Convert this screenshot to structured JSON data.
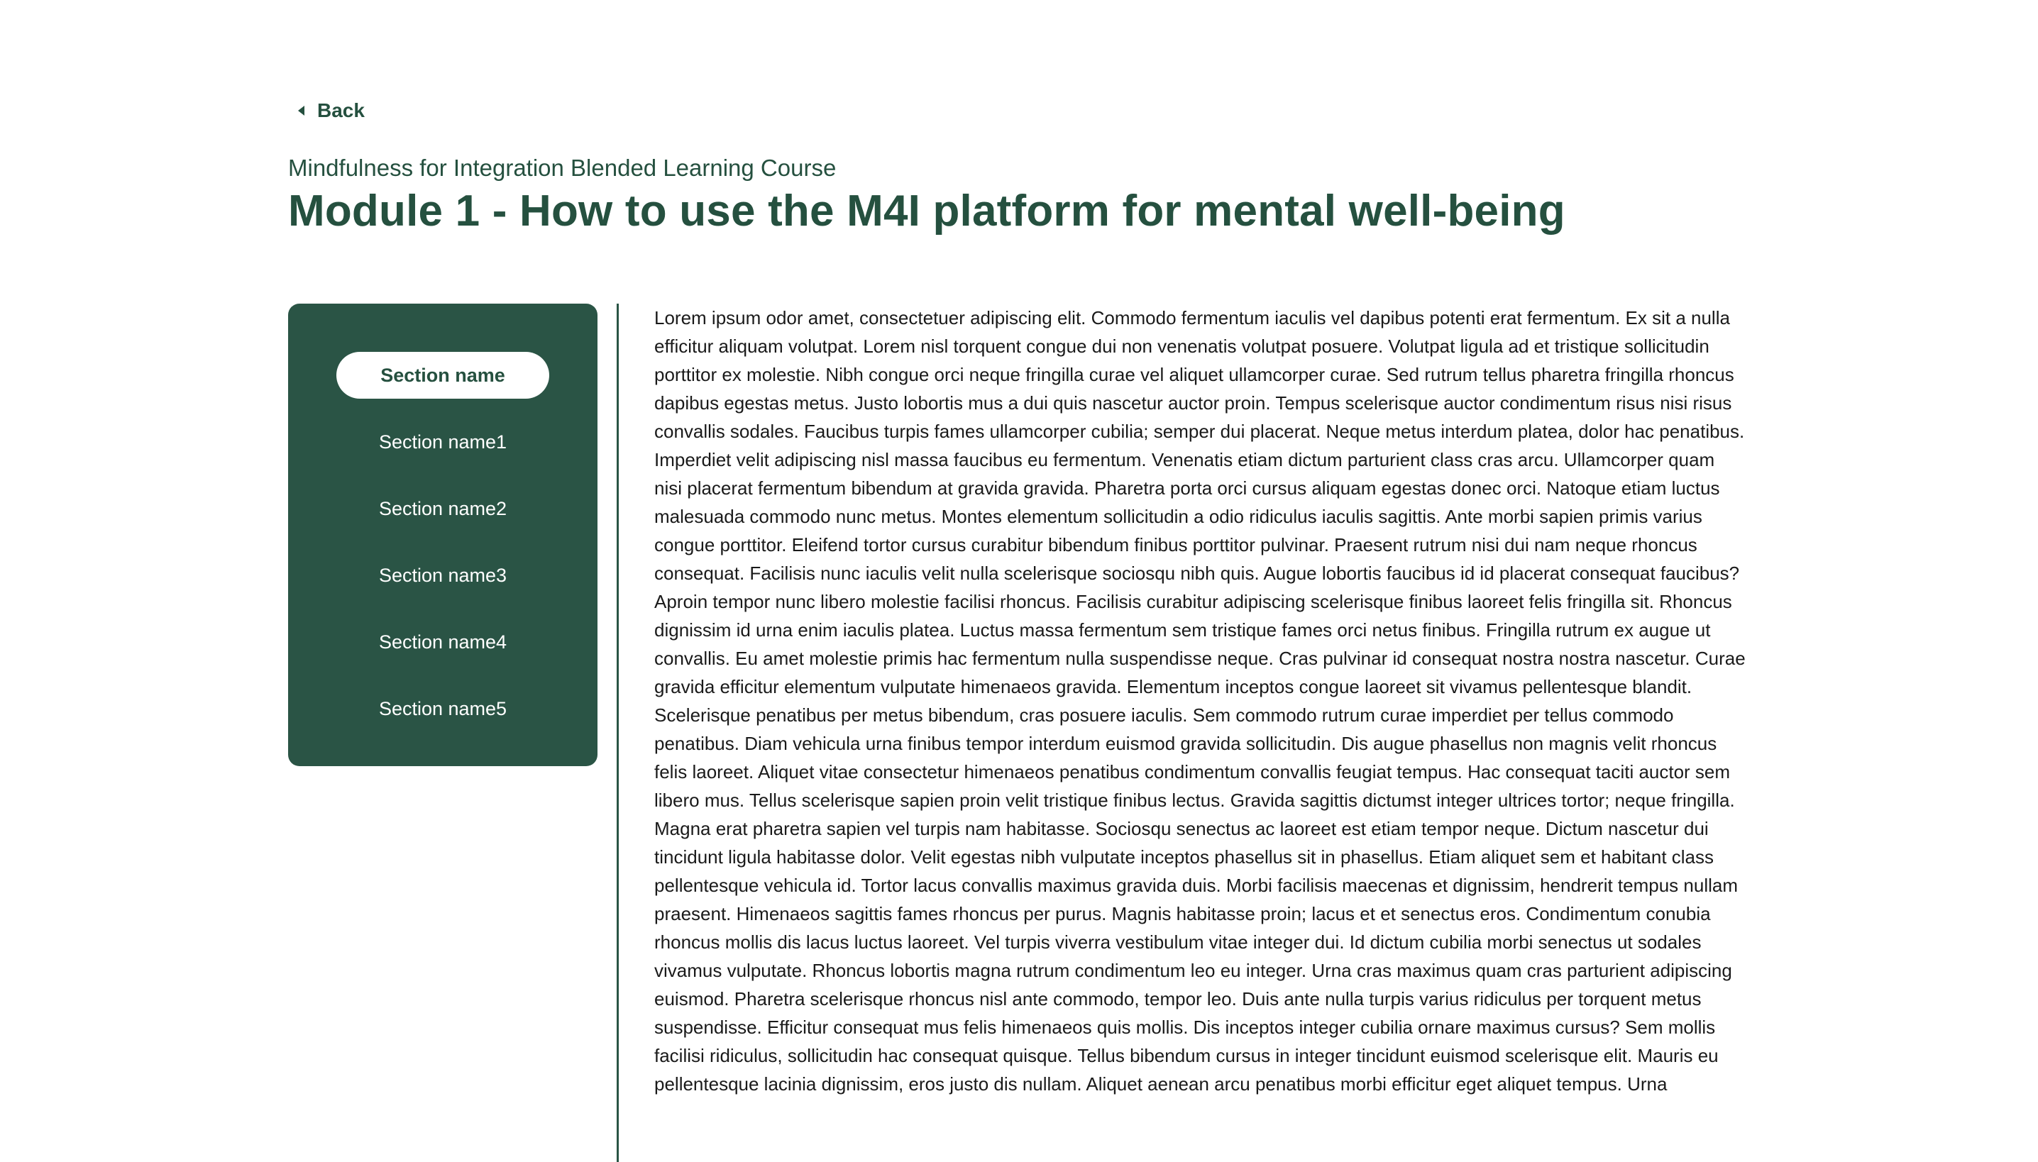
{
  "nav": {
    "back_label": "Back"
  },
  "header": {
    "course_title": "Mindfulness for Integration Blended Learning Course",
    "module_title": "Module 1 - How to use the M4I platform for mental well-being"
  },
  "sidebar": {
    "items": [
      {
        "label": "Section name",
        "active": true
      },
      {
        "label": "Section name1",
        "active": false
      },
      {
        "label": "Section name2",
        "active": false
      },
      {
        "label": "Section name3",
        "active": false
      },
      {
        "label": "Section name4",
        "active": false
      },
      {
        "label": "Section name5",
        "active": false
      }
    ]
  },
  "content": {
    "body": "Lorem ipsum odor amet, consectetuer adipiscing elit. Commodo fermentum iaculis vel dapibus potenti erat fermentum. Ex sit a nulla efficitur aliquam volutpat. Lorem nisl torquent congue dui non venenatis volutpat posuere. Volutpat ligula ad et tristique sollicitudin porttitor ex molestie. Nibh congue orci neque fringilla curae vel aliquet ullamcorper curae. Sed rutrum tellus pharetra fringilla rhoncus dapibus egestas metus. Justo lobortis mus a dui quis nascetur auctor proin. Tempus scelerisque auctor condimentum risus nisi risus convallis sodales. Faucibus turpis fames ullamcorper cubilia; semper dui placerat. Neque metus interdum platea, dolor hac penatibus. Imperdiet velit adipiscing nisl massa faucibus eu fermentum. Venenatis etiam dictum parturient class cras arcu. Ullamcorper quam nisi placerat fermentum bibendum at gravida gravida. Pharetra porta orci cursus aliquam egestas donec orci. Natoque etiam luctus malesuada commodo nunc metus. Montes elementum sollicitudin a odio ridiculus iaculis sagittis. Ante morbi sapien primis varius congue porttitor. Eleifend tortor cursus curabitur bibendum finibus porttitor pulvinar. Praesent rutrum nisi dui nam neque rhoncus consequat. Facilisis nunc iaculis velit nulla scelerisque sociosqu nibh quis. Augue lobortis faucibus id id placerat consequat faucibus? Aproin tempor nunc libero molestie facilisi rhoncus. Facilisis curabitur adipiscing scelerisque finibus laoreet felis fringilla sit. Rhoncus dignissim id urna enim iaculis platea. Luctus massa fermentum sem tristique fames orci netus finibus. Fringilla rutrum ex augue ut convallis. Eu amet molestie primis hac fermentum nulla suspendisse neque. Cras pulvinar id consequat nostra nostra nascetur. Curae gravida efficitur elementum vulputate himenaeos gravida. Elementum inceptos congue laoreet sit vivamus pellentesque blandit. Scelerisque penatibus per metus bibendum, cras posuere iaculis. Sem commodo rutrum curae imperdiet per tellus commodo penatibus. Diam vehicula urna finibus tempor interdum euismod gravida sollicitudin. Dis augue phasellus non magnis velit rhoncus felis laoreet. Aliquet vitae consectetur himenaeos penatibus condimentum convallis feugiat tempus. Hac consequat taciti auctor sem libero mus. Tellus scelerisque sapien proin velit tristique finibus lectus. Gravida sagittis dictumst integer ultrices tortor; neque fringilla. Magna erat pharetra sapien vel turpis nam habitasse. Sociosqu senectus ac laoreet est etiam tempor neque. Dictum nascetur dui tincidunt ligula habitasse dolor. Velit egestas nibh vulputate inceptos phasellus sit in phasellus. Etiam aliquet sem et habitant class pellentesque vehicula id. Tortor lacus convallis maximus gravida duis. Morbi facilisis maecenas et dignissim, hendrerit tempus nullam praesent. Himenaeos sagittis fames rhoncus per purus. Magnis habitasse proin; lacus et et senectus eros. Condimentum conubia rhoncus mollis dis lacus luctus laoreet. Vel turpis viverra vestibulum vitae integer dui. Id dictum cubilia morbi senectus ut sodales vivamus vulputate. Rhoncus lobortis magna rutrum condimentum leo eu integer. Urna cras maximus quam cras parturient adipiscing euismod. Pharetra scelerisque rhoncus nisl ante commodo, tempor leo. Duis ante nulla turpis varius ridiculus per torquent metus suspendisse. Efficitur consequat mus felis himenaeos quis mollis. Dis inceptos integer cubilia ornare maximus cursus? Sem mollis facilisi ridiculus, sollicitudin hac consequat quisque. Tellus bibendum cursus in integer tincidunt euismod scelerisque elit. Mauris eu pellentesque lacinia dignissim, eros justo dis nullam. Aliquet aenean arcu penatibus morbi efficitur eget aliquet tempus. Urna"
  },
  "colors": {
    "brand_green": "#2a5445",
    "title_green": "#25503f",
    "background": "#ffffff"
  }
}
